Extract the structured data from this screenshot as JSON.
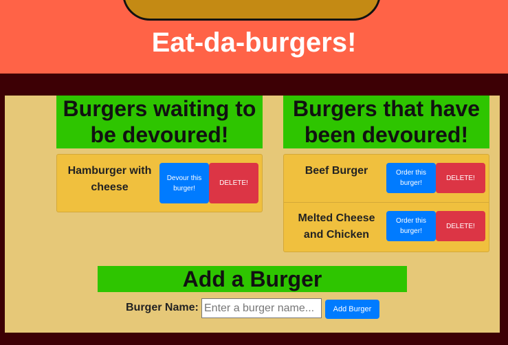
{
  "header": {
    "title": "Eat-da-burgers!"
  },
  "waiting": {
    "title": "Burgers waiting to be devoured!",
    "burgers": [
      {
        "name": "Hamburger with cheese",
        "action_label": "Devour this burger!",
        "delete_label": "DELETE!"
      }
    ]
  },
  "devoured": {
    "title": "Burgers that have been devoured!",
    "burgers": [
      {
        "name": "Beef Burger",
        "action_label": "Order this burger!",
        "delete_label": "DELETE!"
      },
      {
        "name": "Melted Cheese and Chicken",
        "action_label": "Order this burger!",
        "delete_label": "DELETE!"
      }
    ]
  },
  "add_form": {
    "title": "Add a Burger",
    "label": "Burger Name:",
    "placeholder": "Enter a burger name...",
    "submit_label": "Add Burger"
  },
  "colors": {
    "header_bg": "#ff6347",
    "page_bg": "#3d0005",
    "panel_bg": "#e6c878",
    "title_bg": "#2ec500",
    "card_bg": "#f0c03e",
    "primary": "#007bff",
    "danger": "#dc3545"
  }
}
